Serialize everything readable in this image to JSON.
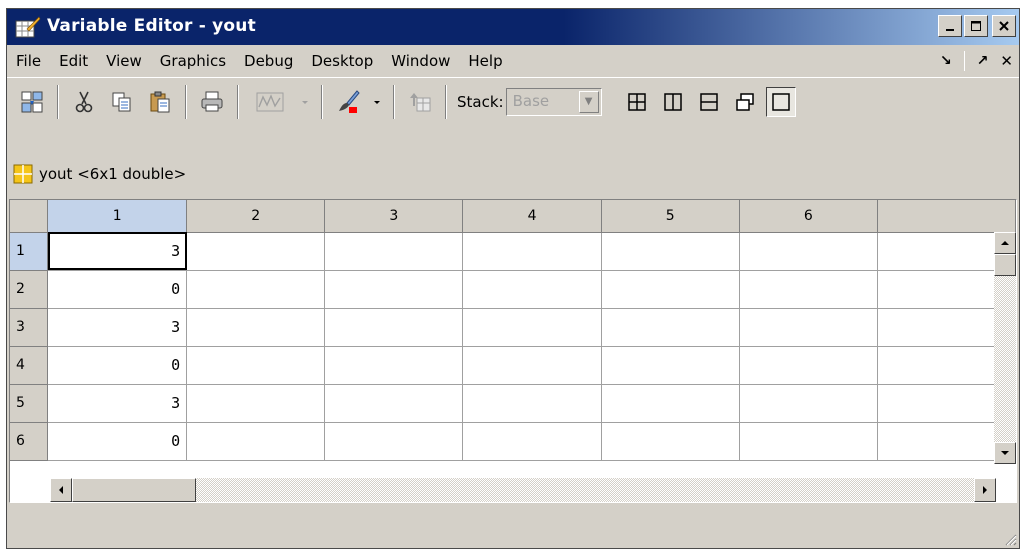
{
  "window": {
    "title": "Variable Editor - yout",
    "minimize_label": "_",
    "maximize_label": "□",
    "close_label": "✕"
  },
  "menu": {
    "items": [
      "File",
      "Edit",
      "View",
      "Graphics",
      "Debug",
      "Desktop",
      "Window",
      "Help"
    ],
    "undock_glyph": "↘",
    "dock_glyph": "↗",
    "close_glyph": "✕"
  },
  "toolbar": {
    "stack_label": "Stack:",
    "stack_value": "Base",
    "icons": [
      "import-data-icon",
      "cut-icon",
      "copy-icon",
      "paste-icon",
      "print-icon",
      "plot-icon",
      "brush-icon",
      "stack-up-icon"
    ],
    "layout_icons": [
      "tile-icon",
      "left-right-icon",
      "top-bottom-icon",
      "float-icon",
      "maximize-icon"
    ]
  },
  "variable": {
    "label": "yout <6x1 double>"
  },
  "grid": {
    "column_headers": [
      "1",
      "2",
      "3",
      "4",
      "5",
      "6"
    ],
    "row_headers": [
      "1",
      "2",
      "3",
      "4",
      "5",
      "6"
    ],
    "values": [
      "3",
      "0",
      "3",
      "0",
      "3",
      "0"
    ]
  },
  "colors": {
    "title_start": "#0a246a",
    "title_end": "#a6caf0",
    "chrome": "#d4d0c8",
    "header_selected": "#c3d3ea"
  }
}
